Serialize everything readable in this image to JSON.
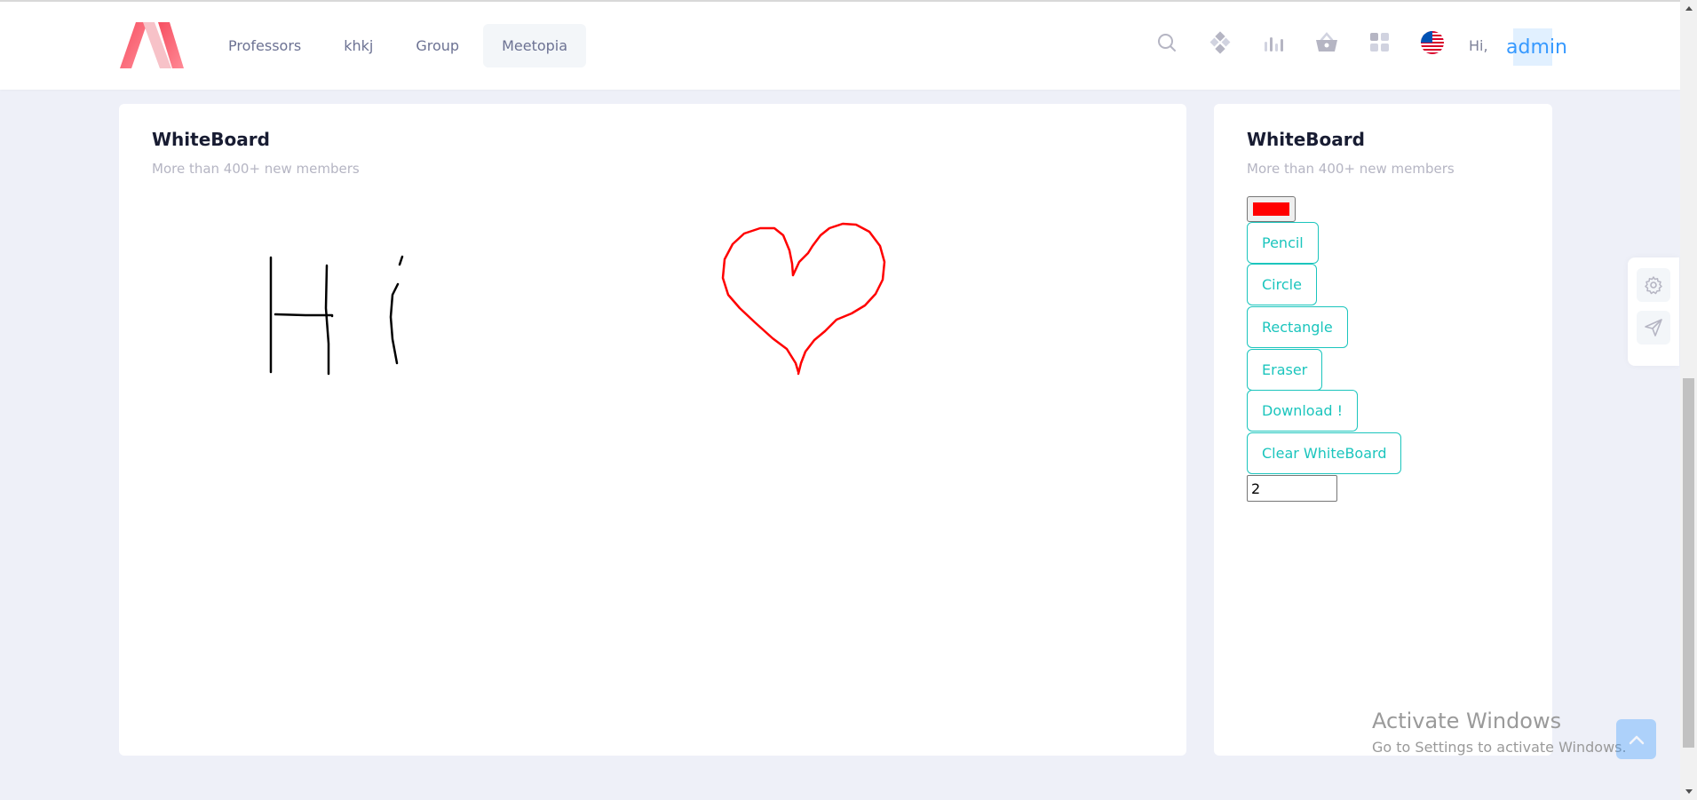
{
  "header": {
    "logo": "metronic-logo",
    "nav": [
      {
        "label": "Professors",
        "active": false
      },
      {
        "label": "khkj",
        "active": false
      },
      {
        "label": "Group",
        "active": false
      },
      {
        "label": "Meetopia",
        "active": true
      }
    ],
    "icons": [
      "search-icon",
      "diamond-grid-icon",
      "bar-chart-icon",
      "basket-icon",
      "apps-icon",
      "us-flag-icon"
    ],
    "greeting": "Hi,",
    "username": "admin"
  },
  "whiteboard_main": {
    "title": "WhiteBoard",
    "subtitle": "More than 400+ new members"
  },
  "whiteboard_tools": {
    "title": "WhiteBoard",
    "subtitle": "More than 400+ new members",
    "color": "#ff0000",
    "buttons": {
      "pencil": "Pencil",
      "circle": "Circle",
      "rectangle": "Rectangle",
      "eraser": "Eraser",
      "download": "Download !",
      "clear": "Clear WhiteBoard"
    },
    "brush_size": "2"
  },
  "side_toolbar": [
    "gear-icon",
    "send-icon"
  ],
  "watermark": {
    "title": "Activate Windows",
    "subtitle": "Go to Settings to activate Windows."
  },
  "colors": {
    "accent": "#3699ff",
    "tool_button": "#1bc5bd",
    "background": "#eef0f8",
    "stroke_red": "#ff0000",
    "stroke_black": "#000000"
  }
}
